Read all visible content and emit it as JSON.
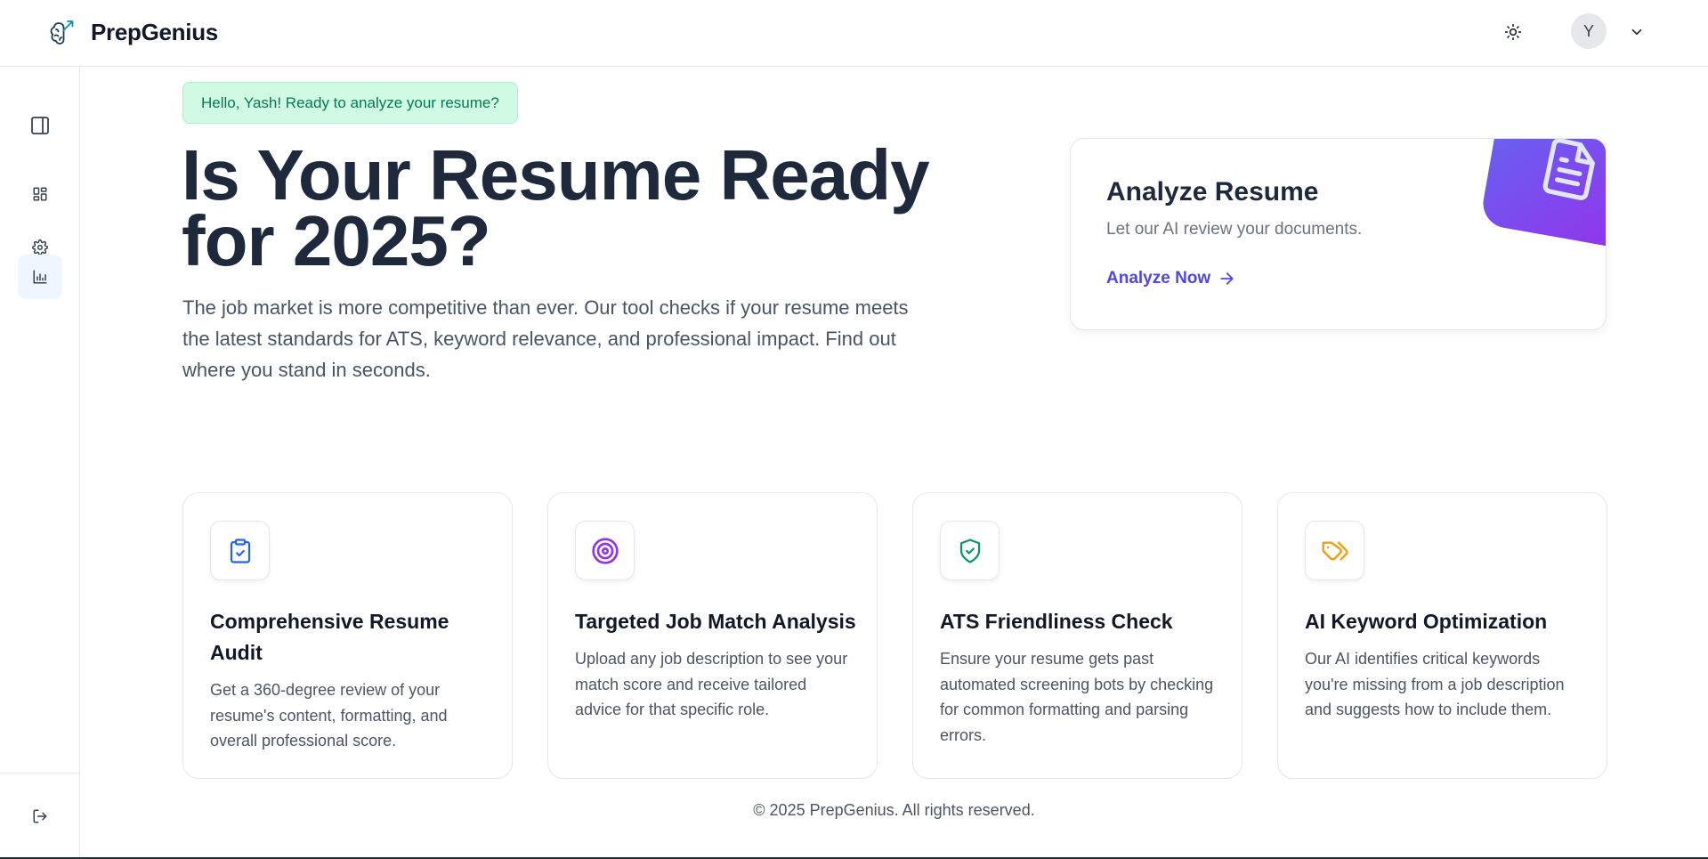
{
  "header": {
    "brand_name": "PrepGenius",
    "avatar_initial": "Y"
  },
  "sidebar": {
    "items": [
      {
        "name": "toggle-sidebar",
        "icon": "panel-left-icon"
      },
      {
        "name": "dashboard",
        "icon": "grid-icon"
      },
      {
        "name": "settings",
        "icon": "gear-icon"
      },
      {
        "name": "analytics",
        "icon": "bar-chart-icon",
        "active": true
      },
      {
        "name": "logout",
        "icon": "logout-icon"
      }
    ]
  },
  "main": {
    "greeting": "Hello, Yash! Ready to analyze your resume?",
    "hero_title_line1": "Is Your Resume Ready",
    "hero_title_line2": "for 2025?",
    "hero_subtitle": "The job market is more competitive than ever. Our tool checks if your resume meets the latest standards for ATS, keyword relevance, and professional impact. Find out where you stand in seconds."
  },
  "analyze_card": {
    "title": "Analyze Resume",
    "subtitle": "Let our AI review your documents.",
    "link_label": "Analyze Now"
  },
  "features": [
    {
      "title": "Comprehensive Resume Audit",
      "description": "Get a 360-degree review of your resume's content, formatting, and overall professional score.",
      "icon": "clipboard-check-icon",
      "color": "#2563eb"
    },
    {
      "title": "Targeted Job Match Analysis",
      "description": "Upload any job description to see your match score and receive tailored advice for that specific role.",
      "icon": "target-icon",
      "color": "#9333ea"
    },
    {
      "title": "ATS Friendliness Check",
      "description": "Ensure your resume gets past automated screening bots by checking for common formatting and parsing errors.",
      "icon": "shield-check-icon",
      "color": "#059669"
    },
    {
      "title": "AI Keyword Optimization",
      "description": "Our AI identifies critical keywords you're missing from a job description and suggests how to include them.",
      "icon": "tags-icon",
      "color": "#f59e0b"
    }
  ],
  "footer": {
    "text": "© 2025 PrepGenius. All rights reserved."
  },
  "colors": {
    "accent": "#4f46e5",
    "greeting_bg": "#d1fae5",
    "greeting_text": "#047857",
    "title": "#1e293b"
  }
}
